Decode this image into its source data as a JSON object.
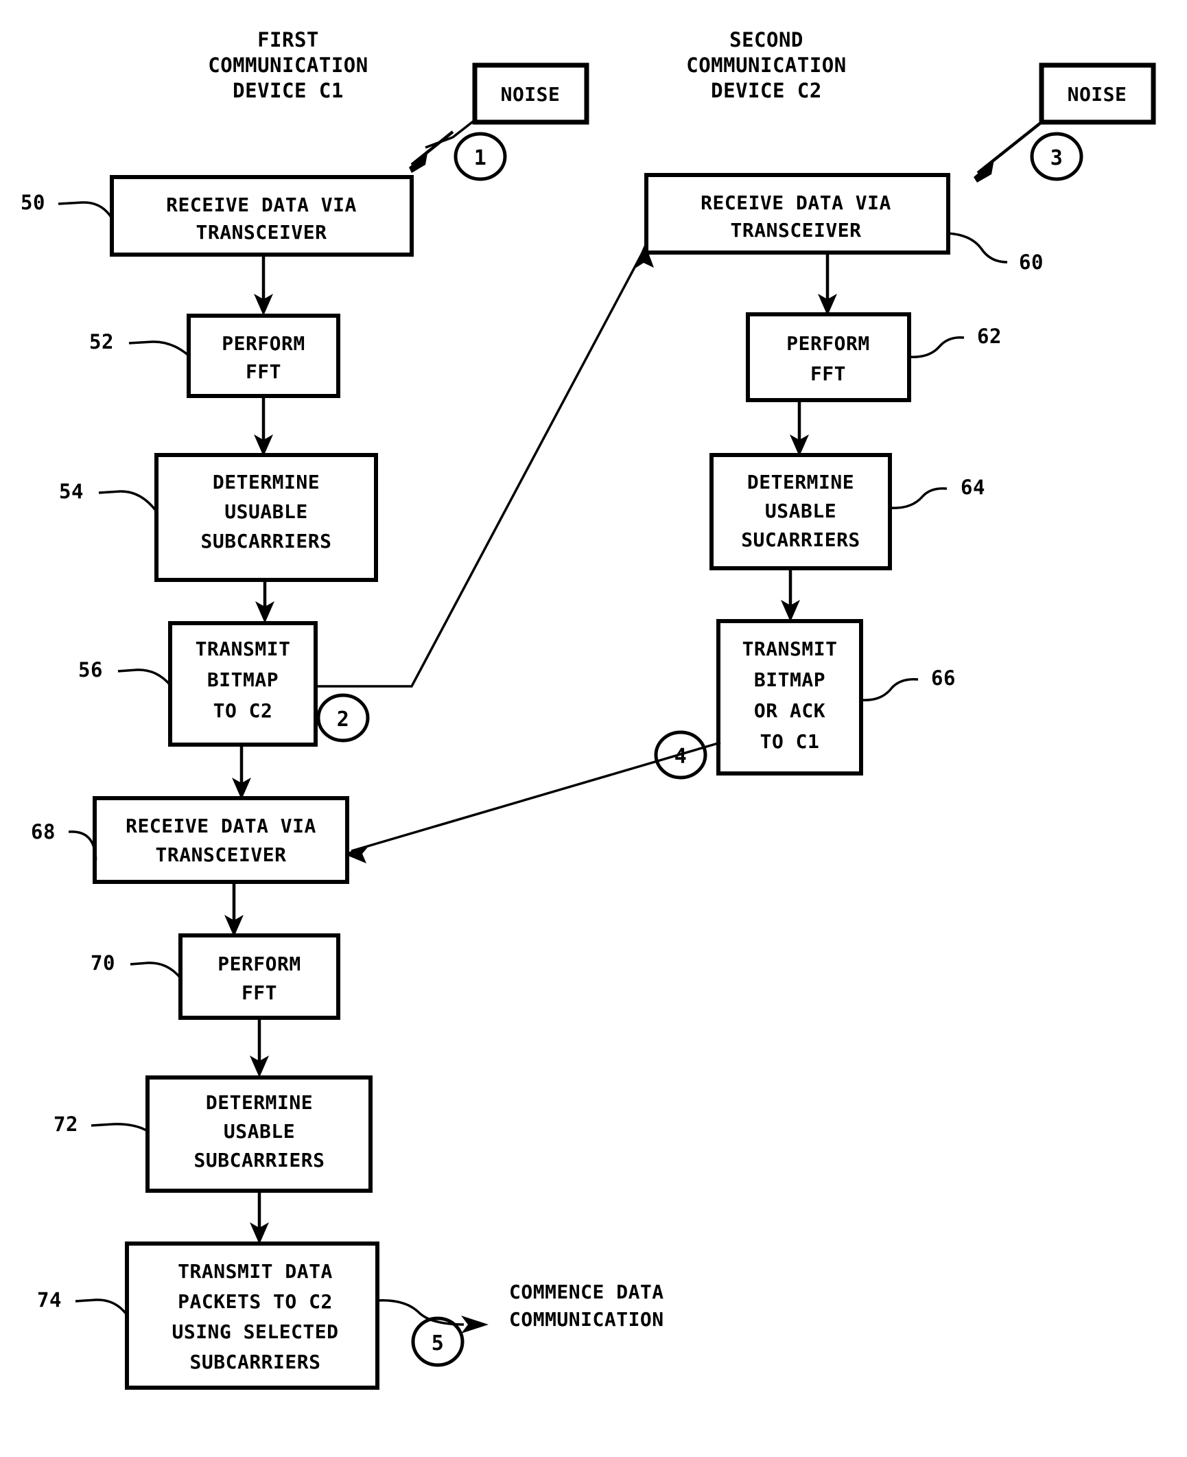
{
  "figure": {
    "background_color": "#ffffff",
    "ink_color": "#000000",
    "headers": {
      "left": {
        "line1": "FIRST",
        "line2": "COMMUNICATION",
        "line3": "DEVICE C1"
      },
      "right": {
        "line1": "SECOND",
        "line2": "COMMUNICATION",
        "line3": "DEVICE C2"
      }
    },
    "noise_boxes": [
      {
        "label": "NOISE",
        "id": "noise-left"
      },
      {
        "label": "NOISE",
        "id": "noise-right"
      }
    ],
    "step_markers": [
      {
        "label": "1"
      },
      {
        "label": "2"
      },
      {
        "label": "3"
      },
      {
        "label": "4"
      },
      {
        "label": "5"
      }
    ],
    "boxes": [
      {
        "ref": "50",
        "lines": [
          "RECEIVE DATA VIA",
          "TRANSCEIVER"
        ]
      },
      {
        "ref": "52",
        "lines": [
          "PERFORM",
          "FFT"
        ]
      },
      {
        "ref": "54",
        "lines": [
          "DETERMINE",
          "USUABLE",
          "SUBCARRIERS"
        ]
      },
      {
        "ref": "56",
        "lines": [
          "TRANSMIT",
          "BITMAP",
          "TO C2"
        ]
      },
      {
        "ref": "60",
        "lines": [
          "RECEIVE DATA VIA",
          "TRANSCEIVER"
        ]
      },
      {
        "ref": "62",
        "lines": [
          "PERFORM",
          "FFT"
        ]
      },
      {
        "ref": "64",
        "lines": [
          "DETERMINE",
          "USABLE",
          "SUCARRIERS"
        ]
      },
      {
        "ref": "66",
        "lines": [
          "TRANSMIT",
          "BITMAP",
          "OR ACK",
          "TO C1"
        ]
      },
      {
        "ref": "68",
        "lines": [
          "RECEIVE DATA VIA",
          "TRANSCEIVER"
        ]
      },
      {
        "ref": "70",
        "lines": [
          "PERFORM",
          "FFT"
        ]
      },
      {
        "ref": "72",
        "lines": [
          "DETERMINE",
          "USABLE",
          "SUBCARRIERS"
        ]
      },
      {
        "ref": "74",
        "lines": [
          "TRANSMIT DATA",
          "PACKETS TO C2",
          "USING SELECTED",
          "SUBCARRIERS"
        ]
      }
    ],
    "terminal_text": {
      "line1": "COMMENCE DATA",
      "line2": "COMMUNICATION"
    }
  }
}
